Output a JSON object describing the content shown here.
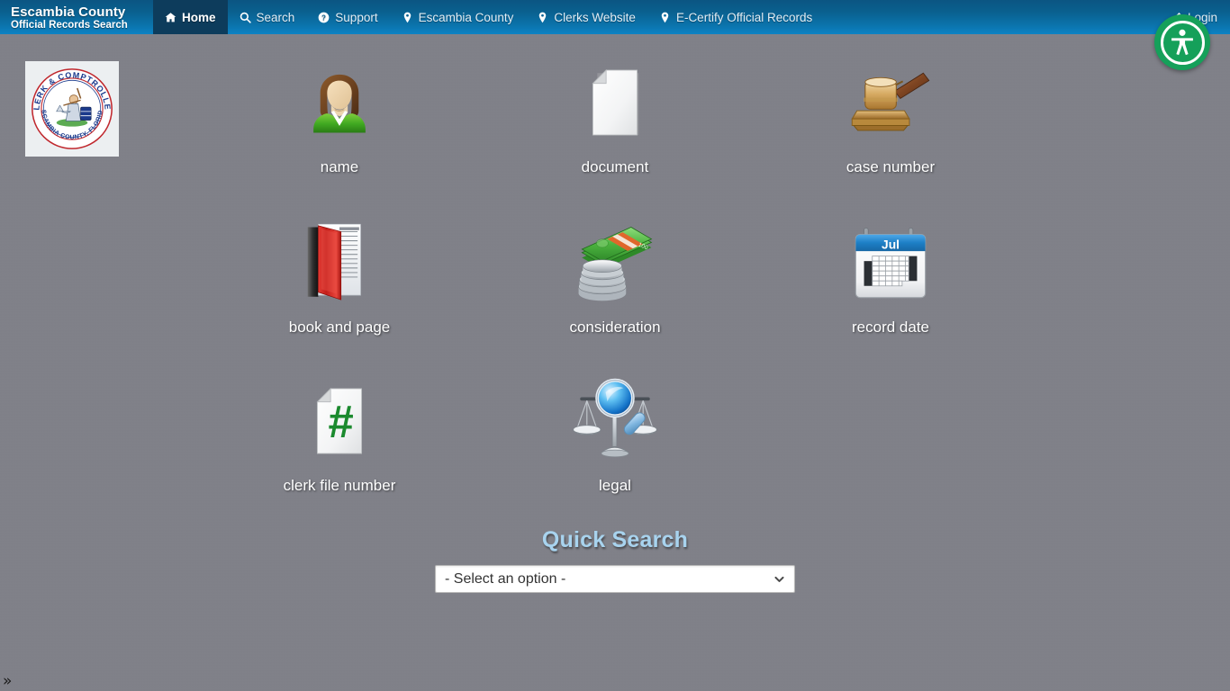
{
  "navbar": {
    "brand_line1": "Escambia County",
    "brand_line2": "Official Records Search",
    "items": [
      {
        "label": "Home",
        "icon": "home-icon",
        "active": true
      },
      {
        "label": "Search",
        "icon": "search-icon",
        "active": false
      },
      {
        "label": "Support",
        "icon": "help-circle-icon",
        "active": false
      },
      {
        "label": "Escambia County",
        "icon": "map-pin-icon",
        "active": false
      },
      {
        "label": "Clerks Website",
        "icon": "map-pin-icon",
        "active": false
      },
      {
        "label": "E-Certify Official Records",
        "icon": "map-pin-icon",
        "active": false
      }
    ],
    "login": {
      "label": "Login",
      "icon": "pencil-icon"
    },
    "colors": {
      "gradient_top": "#0b5582",
      "gradient_bottom": "#0c82c4",
      "active_tab": "#0d3c5c"
    }
  },
  "accessibility_widget": {
    "name": "accessibility-button",
    "color": "#15a05a"
  },
  "seal": {
    "top_text": "CLERK & COMPTROLLER",
    "bottom_text": "ESCAMBIA COUNTY, FLORIDA",
    "alt": "Clerk & Comptroller Escambia County Florida seal"
  },
  "search_tiles": [
    {
      "label": "name",
      "icon": "person-icon"
    },
    {
      "label": "document",
      "icon": "document-icon"
    },
    {
      "label": "case number",
      "icon": "gavel-icon"
    },
    {
      "label": "book and page",
      "icon": "book-icon"
    },
    {
      "label": "consideration",
      "icon": "money-icon"
    },
    {
      "label": "record date",
      "icon": "calendar-icon"
    },
    {
      "label": "clerk file number",
      "icon": "hash-document-icon"
    },
    {
      "label": "legal",
      "icon": "scales-magnifier-icon"
    }
  ],
  "calendar_icon": {
    "month": "Jul"
  },
  "quick_search": {
    "title": "Quick Search",
    "select_value": "- Select an option -",
    "title_color": "#a8d3ee"
  },
  "bottom_toggle": {
    "label": "»"
  },
  "page": {
    "background_color": "#808189"
  }
}
